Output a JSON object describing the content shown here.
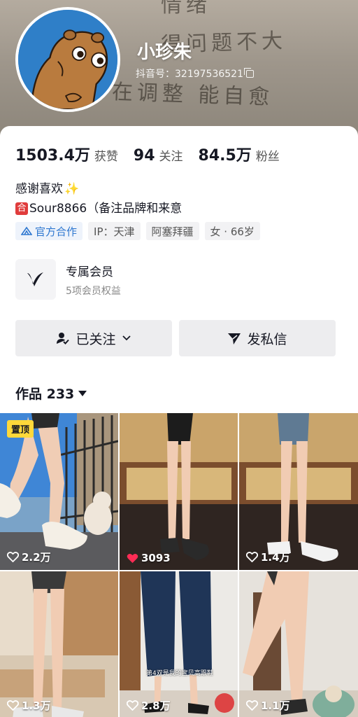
{
  "header": {
    "nickname": "小珍朱",
    "douyin_id": "抖音号：32197536521",
    "background_text_line0": "情绪",
    "background_text_line1": "得问题不大",
    "background_text_line2": "在调整 能自愈"
  },
  "stats": [
    {
      "value": "1503.4万",
      "label": "获赞"
    },
    {
      "value": "94",
      "label": "关注"
    },
    {
      "value": "84.5万",
      "label": "粉丝"
    }
  ],
  "bio": {
    "line1": "感谢喜欢",
    "line1_emoji": "✨",
    "line2_badge": "合",
    "line2_text": "Sour8866（备注品牌和来意"
  },
  "tags": [
    {
      "label": "官方合作",
      "icon": "official-cooperation-icon"
    },
    {
      "label": "IP：天津"
    },
    {
      "label": "阿塞拜疆"
    },
    {
      "label": "女 · 66岁"
    }
  ],
  "member": {
    "title": "专属会员",
    "subtitle": "5项会员权益",
    "icon": "v-logo-icon"
  },
  "actions": {
    "followed_label": "已关注",
    "message_label": "发私信"
  },
  "works": {
    "label": "作品 233"
  },
  "videos": [
    {
      "likes": "2.2万",
      "pinned_label": "置顶",
      "liked": false
    },
    {
      "likes": "3093",
      "liked": true
    },
    {
      "likes": "1.4万",
      "liked": false
    },
    {
      "likes": "1.3万",
      "liked": false
    },
    {
      "likes": "2.8万",
      "liked": false,
      "caption": "第4双是我的宝贝高跟鞋"
    },
    {
      "likes": "1.1万",
      "liked": false
    }
  ],
  "colors": {
    "accent_official": "#2e77d0",
    "pin_badge": "#fed83a",
    "liked_heart": "#fe2c55"
  }
}
